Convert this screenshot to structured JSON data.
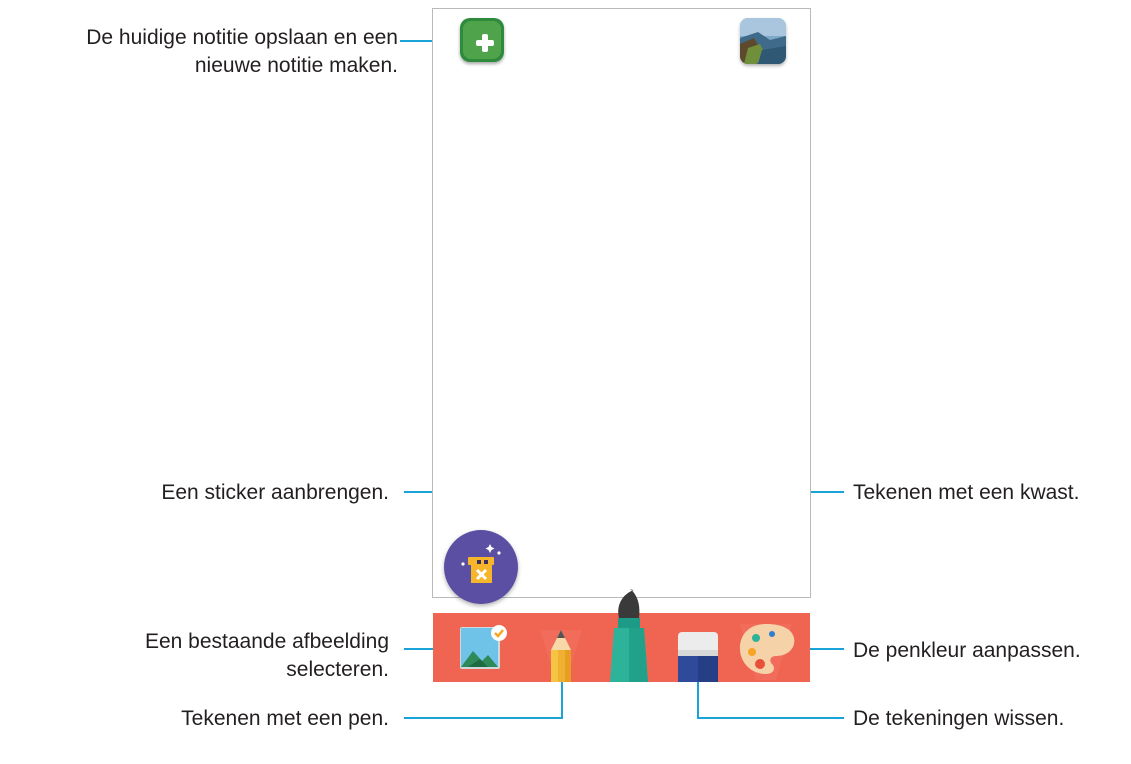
{
  "callouts": {
    "new_note": [
      "De huidige notitie opslaan en een",
      "nieuwe notitie maken."
    ],
    "sticker": "Een sticker aanbrengen.",
    "image": [
      "Een bestaande afbeelding",
      "selecteren."
    ],
    "pen": "Tekenen met een pen.",
    "brush": "Tekenen met een kwast.",
    "palette": "De penkleur aanpassen.",
    "eraser": "De tekeningen wissen."
  },
  "colors": {
    "toolbar": "#f06552",
    "callout_line": "#1aa3d9",
    "sticker_button": "#5b4fa3",
    "new_note_button": "#4fa34b"
  },
  "icons": {
    "new_note": "plus-icon",
    "background": "landscape-thumbnail",
    "sticker": "gift-box-icon",
    "image": "image-icon",
    "pen": "pencil-icon",
    "brush": "brush-icon",
    "eraser": "eraser-icon",
    "palette": "palette-icon"
  }
}
